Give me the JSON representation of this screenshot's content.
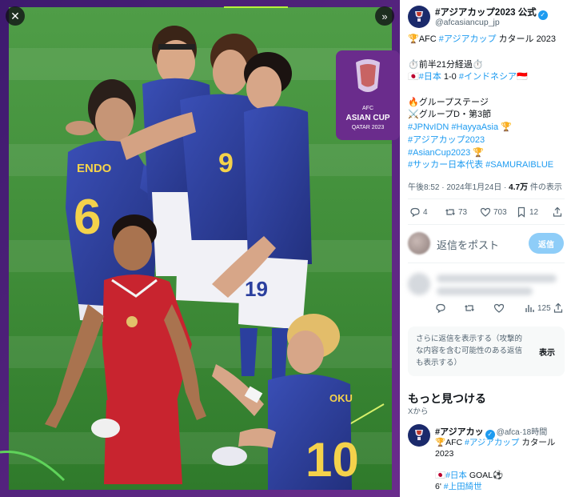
{
  "viewer": {
    "close_icon": "close-icon",
    "expand_icon": "chevrons-right-icon",
    "badge": {
      "line1": "AFC",
      "line2": "ASIAN CUP",
      "line3": "QATAR 2023",
      "color": "#6a2c8c"
    },
    "jerseys": {
      "endo": "ENDO",
      "endo_number": "6",
      "number_9": "9",
      "number_19": "19",
      "kubo_name": "OKU",
      "kubo_number": "10"
    }
  },
  "post": {
    "author_name": "#アジアカップ2023 公式",
    "author_handle": "@afcasiancup_jp",
    "line1_prefix": "🏆AFC ",
    "line1_tag": "#アジアカップ",
    "line1_suffix": " カタール 2023",
    "line2": "⏱️前半21分経過⏱️",
    "line3_prefix": "🇯🇵",
    "line3_tag1": "#日本",
    "line3_score": " 1-0 ",
    "line3_tag2": "#インドネシア",
    "line3_suffix": "🇮🇩",
    "line4": "🔥グループステージ",
    "line5": "⚔️グループD・第3節",
    "line6_tags": "#JPNvIDN #HayyaAsia",
    "line6_suffix": " 🏆",
    "line7": "#アジアカップ2023",
    "line8_tag": "#AsianCup2023",
    "line8_suffix": " 🏆",
    "line9": "#サッカー日本代表 #SAMURAIBLUE",
    "meta_time": "午後8:52 · 2024年1月24日 · ",
    "meta_views_count": "4.7万",
    "meta_views_label": " 件の表示"
  },
  "actions": {
    "replies": "4",
    "reposts": "73",
    "likes": "703",
    "bookmarks": "12"
  },
  "reply_box": {
    "placeholder": "返信をポスト",
    "button": "返信"
  },
  "blurred_reply_actions": {
    "views": "125"
  },
  "more_replies": {
    "text": "さらに返信を表示する（攻撃的な内容を含む可能性のある返信も表示する）",
    "button": "表示"
  },
  "discover": {
    "title": "もっと見つける",
    "source": "Xから"
  },
  "related_post": {
    "name": "#アジアカッ",
    "handle": "@afca·",
    "time": "18時間",
    "line1_prefix": "🏆AFC ",
    "line1_tag": "#アジアカップ",
    "line1_suffix": " カタール",
    "line2": "2023",
    "line3_prefix": "🇯🇵",
    "line3_tag": "#日本",
    "line3_suffix": " GOAL⚽",
    "line4_prefix": "6' ",
    "line4_tag": "#上田綺世"
  },
  "colors": {
    "link": "#1d9bf0",
    "japan_blue": "#2b3f9e",
    "indonesia_red": "#c8242f",
    "pitch_green": "#3f8f3a"
  }
}
